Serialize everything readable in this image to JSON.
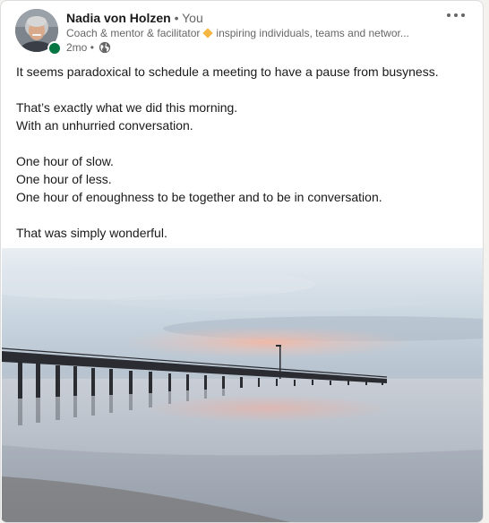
{
  "author": {
    "name": "Nadia von Holzen",
    "separator": "•",
    "relation": "You",
    "headline_part1": "Coach & mentor & facilitator",
    "headline_part2": "inspiring individuals, teams and networ...",
    "time_ago": "2mo",
    "time_separator": "•",
    "avatar_icon": "avatar-photo",
    "presence_status": "online",
    "visibility_icon": "globe-icon"
  },
  "menu": {
    "more_icon": "ellipsis-icon"
  },
  "post": {
    "paragraphs": [
      [
        "It seems paradoxical to schedule a meeting to have a pause from busyness."
      ],
      [
        "That’s exactly what we did this morning.",
        "With an unhurried conversation."
      ],
      [
        "One hour of slow.",
        "One hour of less.",
        "One hour of enoughness to be together and to be in conversation."
      ],
      [
        "That was simply wonderful."
      ]
    ],
    "image": "pier-at-dawn-photo"
  },
  "colors": {
    "presence": "#057642",
    "diamond": "#f5b642",
    "text": "#191919",
    "muted": "#666666"
  }
}
